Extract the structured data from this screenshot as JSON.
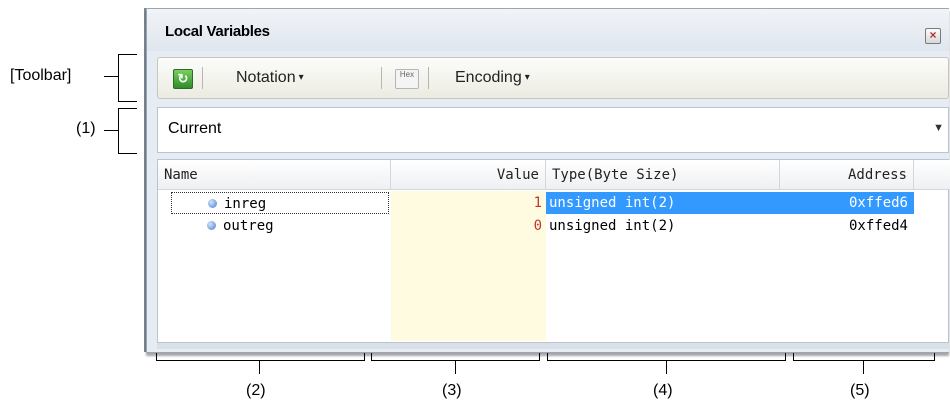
{
  "annotations": {
    "toolbar": "[Toolbar]",
    "one": "(1)",
    "two": "(2)",
    "three": "(3)",
    "four": "(4)",
    "five": "(5)"
  },
  "window": {
    "title": "Local Variables",
    "close_icon": "close-icon"
  },
  "toolbar": {
    "refresh_icon": "refresh-icon",
    "notation_label": "Notation",
    "hex_icon": "hex-icon",
    "hex_text": "Hex",
    "encoding_label": "Encoding"
  },
  "scope_combo": {
    "value": "Current"
  },
  "grid": {
    "columns": [
      "Name",
      "Value",
      "Type(Byte Size)",
      "Address"
    ],
    "rows": [
      {
        "name": "inreg",
        "value": "1",
        "type": "unsigned int(2)",
        "address": "0xffed6"
      },
      {
        "name": "outreg",
        "value": "0",
        "type": "unsigned int(2)",
        "address": "0xffed4"
      }
    ]
  },
  "colors": {
    "selection": "#3399ff",
    "value_text": "#c0392b",
    "value_bg": "#fffbe0"
  }
}
